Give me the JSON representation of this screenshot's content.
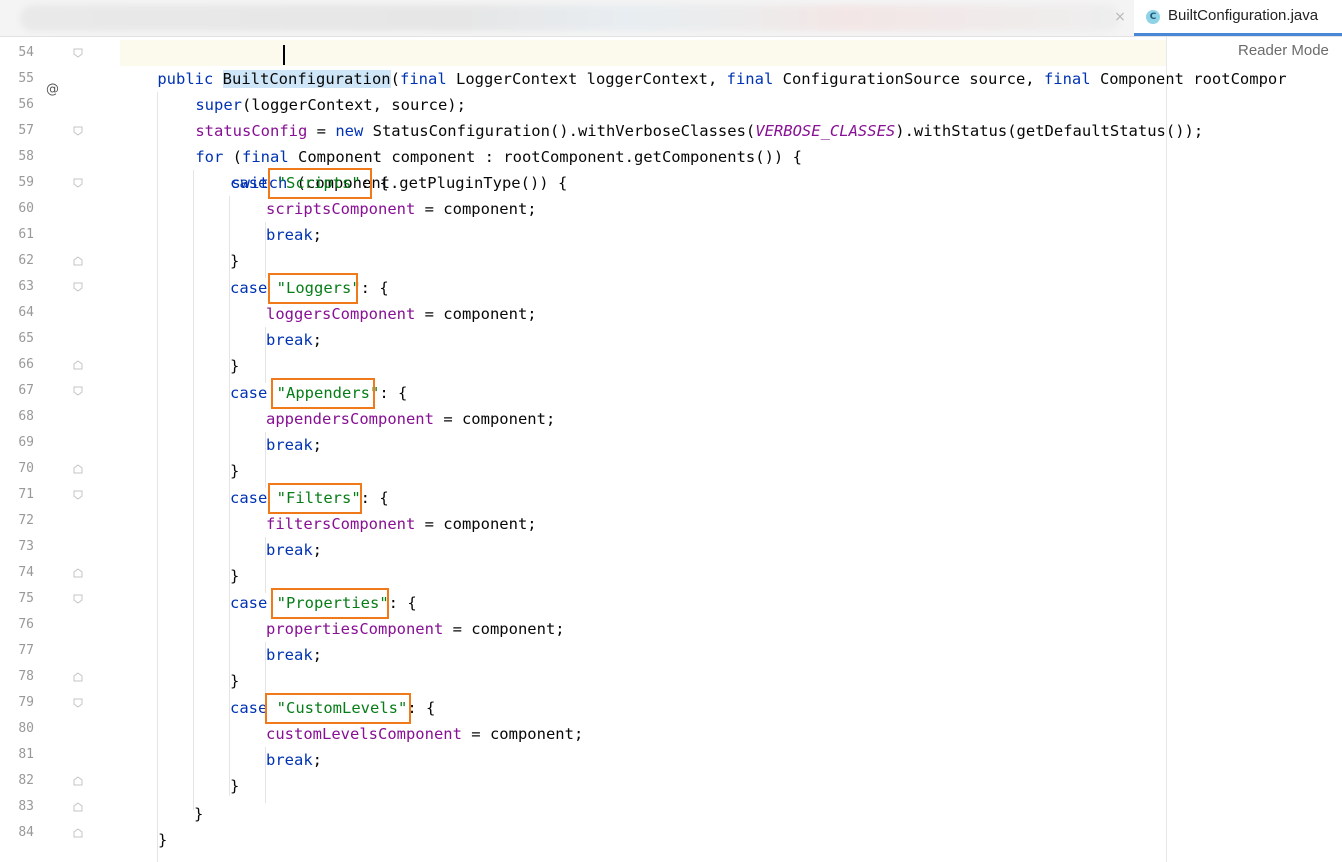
{
  "tab": {
    "file_name": "BuiltConfiguration.java",
    "file_icon": "C",
    "close_symbol": "×"
  },
  "editor": {
    "reader_mode_label": "Reader Mode",
    "gutter_annotation": "@",
    "line_numbers": [
      "54",
      "55",
      "56",
      "57",
      "58",
      "59",
      "60",
      "61",
      "62",
      "63",
      "64",
      "65",
      "66",
      "67",
      "68",
      "69",
      "70",
      "71",
      "72",
      "73",
      "74",
      "75",
      "76",
      "77",
      "78",
      "79",
      "80",
      "81",
      "82",
      "83",
      "84"
    ],
    "code": {
      "l54": {
        "public": "public",
        "name": "BuiltConfiguration",
        "params": "(final LoggerContext loggerContext, final ConfigurationSource source, final Component rootCompor",
        "final": "final"
      },
      "l55": {
        "super": "super",
        "rest": "(loggerContext, source);"
      },
      "l56": {
        "field": "statusConfig",
        "eq": " = ",
        "new": "new",
        "mid": " StatusConfiguration().withVerboseClasses(",
        "const": "VERBOSE_CLASSES",
        "tail": ").withStatus(getDefaultStatus());"
      },
      "l57": {
        "for": "for",
        "rest": " (",
        "final": "final",
        "tail": " Component component : rootComponent.getComponents()) {"
      },
      "l58": {
        "switch": "switch",
        "rest": " (component.getPluginType()) {"
      },
      "case_kw": "case",
      "break_kw": "break",
      "close_brace": "}",
      "cases": [
        {
          "label": "\"Scripts\"",
          "field": "scriptsComponent"
        },
        {
          "label": "\"Loggers\"",
          "field": "loggersComponent"
        },
        {
          "label": "\"Appenders\"",
          "field": "appendersComponent"
        },
        {
          "label": "\"Filters\"",
          "field": "filtersComponent"
        },
        {
          "label": "\"Properties\"",
          "field": "propertiesComponent"
        },
        {
          "label": "\"CustomLevels\"",
          "field": "customLevelsComponent"
        }
      ],
      "case_tail": ": {",
      "assign_tail": " = component;",
      "semicolon": ";"
    }
  },
  "colors": {
    "keyword": "#0033b3",
    "field": "#871094",
    "string": "#067d17",
    "highlight_box": "#f07a1a",
    "selection": "#cfe6f8"
  }
}
